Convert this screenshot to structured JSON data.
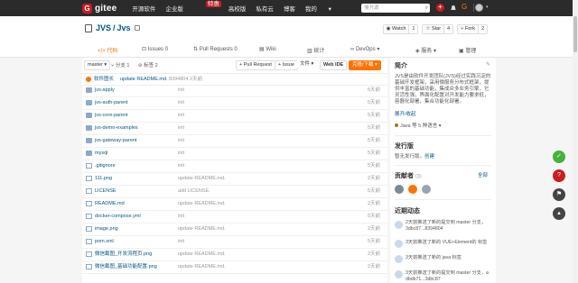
{
  "topbar": {
    "logo_mark": "G",
    "logo_text": "gitee",
    "nav": [
      "开源软件",
      "企业版",
      "高校版",
      "私有云",
      "博客",
      "我的"
    ],
    "beta_badge": "特惠",
    "my_caret": "▾",
    "search_placeholder": "搜开源",
    "plus": "+",
    "g_badge": "G"
  },
  "repo": {
    "owner": "JVS",
    "separator": "/",
    "name": "Jvs",
    "watch_label": "Watch",
    "watch_count": "1",
    "star_label": "Star",
    "star_count": "4",
    "fork_label": "Fork",
    "fork_count": "2"
  },
  "tabs": [
    "代码",
    "Issues",
    "0",
    "Pull Requests",
    "0",
    "Wiki",
    "统计",
    "DevOps",
    "服务",
    "管理"
  ],
  "toolbar": {
    "branch": "master",
    "branches": "分支 1",
    "tags": "标签 2",
    "pull_request": "+ Pull Request",
    "issue": "+ Issue",
    "file": "文件",
    "web_ide": "Web IDE",
    "clone": "克隆/下载"
  },
  "commit": {
    "author": "软件图长",
    "message": "update README.md.",
    "hash": "8394804",
    "time": "2天前"
  },
  "files": [
    {
      "name": "jvs-apply",
      "msg": "init",
      "time": "5天前",
      "type": "folder"
    },
    {
      "name": "jvs-auth-parent",
      "msg": "init",
      "time": "5天前",
      "type": "folder"
    },
    {
      "name": "jvs-core-parent",
      "msg": "init",
      "time": "5天前",
      "type": "folder"
    },
    {
      "name": "jvs-demo-examples",
      "msg": "init",
      "time": "5天前",
      "type": "folder"
    },
    {
      "name": "jvs-gateway-parent",
      "msg": "init",
      "time": "5天前",
      "type": "folder"
    },
    {
      "name": "mysql",
      "msg": "init",
      "time": "5天前",
      "type": "folder"
    },
    {
      "name": ".gitignore",
      "msg": "init",
      "time": "5天前",
      "type": "file"
    },
    {
      "name": "111.png",
      "msg": "update README.md.",
      "time": "2天前",
      "type": "file"
    },
    {
      "name": "LICENSE",
      "msg": "add LICENSE.",
      "time": "5天前",
      "type": "file"
    },
    {
      "name": "README.md",
      "msg": "update README.md.",
      "time": "2天前",
      "type": "file"
    },
    {
      "name": "docker-compose.yml",
      "msg": "init",
      "time": "5天前",
      "type": "file"
    },
    {
      "name": "image.png",
      "msg": "update README.md.",
      "time": "2天前",
      "type": "file"
    },
    {
      "name": "pom.xml",
      "msg": "init",
      "time": "5天前",
      "type": "file"
    },
    {
      "name": "微信截图_开发流程页.png",
      "msg": "update README.md.",
      "time": "2天前",
      "type": "file"
    },
    {
      "name": "微信截图_基础功能配置.png",
      "msg": "update README.md.",
      "time": "2天前",
      "type": "file"
    }
  ],
  "sidebar": {
    "intro_title": "简介",
    "intro_text": [
      "JVS是由软件开发团队(JVS)经过实践沉淀的",
      "基础开发框架，采用微服务分布式框架，提",
      "供丰富的基础功能，集成众多业务引擎，它",
      "灵活性强，界面化配置对开发能力要求低，",
      "容器化部署，集合功能化部署。"
    ],
    "expand": "展开/收起",
    "lang": "Java 等 5 种语言",
    "lang_caret": "▾",
    "release_title": "发行版",
    "release_text": "暂无发行版，",
    "release_link": "创建",
    "contrib_title": "贡献者",
    "contrib_count": "(3)",
    "contrib_all": "全部",
    "activity_title": "近期动态",
    "activity": [
      {
        "line1": "2天前推送了新的提交到 master 分支，",
        "line2": "3dbc87...8394804"
      },
      {
        "line1": "3天前推送了新的 VUE+Element的 标签",
        "line2": ""
      },
      {
        "line1": "3天前推送了新的 java 标签",
        "line2": ""
      },
      {
        "line1": "3天前推送了新的提交到 master 分支，a",
        "line2": "dbdb71...3dbc87"
      }
    ]
  },
  "float_buttons": [
    "✓",
    "?",
    "⚑",
    "▴"
  ]
}
